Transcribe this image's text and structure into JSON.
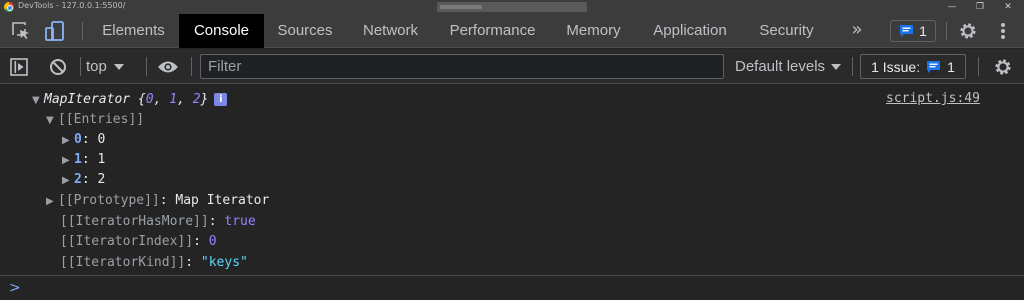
{
  "window": {
    "title": "DevTools - 127.0.0.1:5500/",
    "controls": [
      "—",
      "❐",
      "✕"
    ]
  },
  "tabs": [
    {
      "label": "Elements"
    },
    {
      "label": "Console",
      "active": true
    },
    {
      "label": "Sources"
    },
    {
      "label": "Network"
    },
    {
      "label": "Performance"
    },
    {
      "label": "Memory"
    },
    {
      "label": "Application"
    },
    {
      "label": "Security"
    }
  ],
  "tabbar": {
    "more": "»",
    "issues_count": "1"
  },
  "toolbar": {
    "context": "top",
    "filter_placeholder": "Filter",
    "levels": "Default levels",
    "issues_label": "1 Issue:",
    "issues_count": "1"
  },
  "console": {
    "source": "script.js:49",
    "object_name": "MapIterator",
    "preview_open": " {",
    "preview_values": [
      "0",
      "1",
      "2"
    ],
    "preview_close": "}",
    "info_badge": "i",
    "entries_label": "[[Entries]]",
    "entries": [
      {
        "key": "0",
        "value": "0"
      },
      {
        "key": "1",
        "value": "1"
      },
      {
        "key": "2",
        "value": "2"
      }
    ],
    "prototype_label": "[[Prototype]]",
    "prototype_value": "Map Iterator",
    "has_more_label": "[[IteratorHasMore]]",
    "has_more_value": "true",
    "index_label": "[[IteratorIndex]]",
    "index_value": "0",
    "kind_label": "[[IteratorKind]]",
    "kind_value": "\"keys\""
  },
  "prompt": ">",
  "colors": {
    "background": "#242424",
    "accent": "#7cacf8",
    "number": "#9980ff",
    "string": "#5cd5fb",
    "badge": "#1a73e8"
  }
}
